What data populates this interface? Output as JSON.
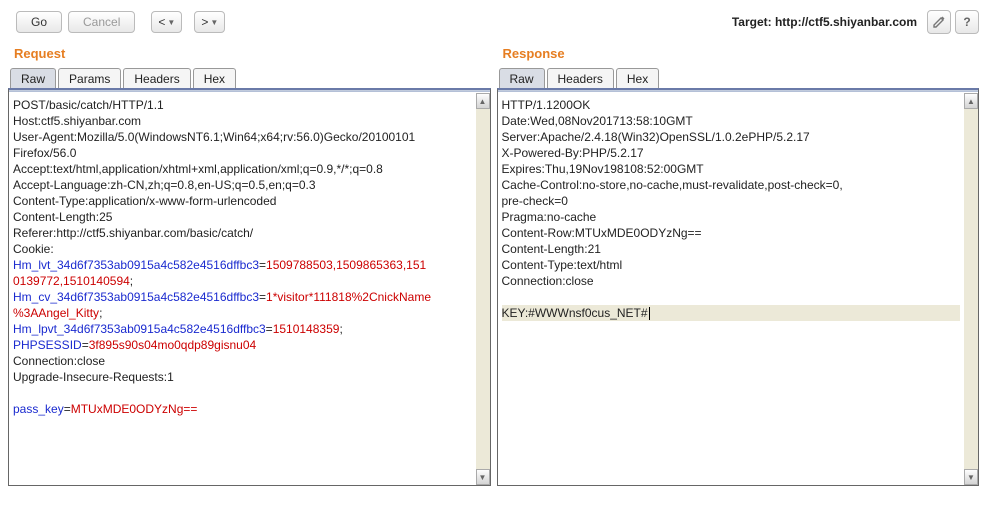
{
  "toolbar": {
    "go_label": "Go",
    "cancel_label": "Cancel",
    "prev_label": "<",
    "next_label": ">",
    "target_prefix": "Target: ",
    "target_url": "http://ctf5.shiyanbar.com",
    "help_label": "?"
  },
  "request": {
    "title": "Request",
    "tabs": {
      "raw": "Raw",
      "params": "Params",
      "headers": "Headers",
      "hex": "Hex"
    },
    "lines": [
      {
        "t": "POST/basic/catch/HTTP/1.1"
      },
      {
        "t": "Host:ctf5.shiyanbar.com"
      },
      {
        "t": "User-Agent:Mozilla/5.0(WindowsNT6.1;Win64;x64;rv:56.0)Gecko/20100101"
      },
      {
        "t": "Firefox/56.0"
      },
      {
        "t": "Accept:text/html,application/xhtml+xml,application/xml;q=0.9,*/*;q=0.8"
      },
      {
        "t": "Accept-Language:zh-CN,zh;q=0.8,en-US;q=0.5,en;q=0.3"
      },
      {
        "t": "Content-Type:application/x-www-form-urlencoded"
      },
      {
        "t": "Content-Length:25"
      },
      {
        "t": "Referer:http://ctf5.shiyanbar.com/basic/catch/"
      },
      {
        "t": "Cookie:"
      },
      {
        "pairs": [
          {
            "k": "Hm_lvt_34d6f7353ab0915a4c582e4516dffbc3",
            "v": "1509788503,1509865363,151"
          }
        ]
      },
      {
        "pairs": [
          {
            "k": "",
            "v": "0139772,1510140594",
            "semi": true
          }
        ]
      },
      {
        "pairs": [
          {
            "k": "Hm_cv_34d6f7353ab0915a4c582e4516dffbc3",
            "v": "1*visitor*111818%2CnickName"
          }
        ]
      },
      {
        "pairs": [
          {
            "k": "",
            "v": "%3AAngel_Kitty",
            "semi": true
          }
        ]
      },
      {
        "pairs": [
          {
            "k": "Hm_lpvt_34d6f7353ab0915a4c582e4516dffbc3",
            "v": "1510148359",
            "semi": true
          }
        ]
      },
      {
        "pairs": [
          {
            "k": "PHPSESSID",
            "v": "3f895s90s04mo0qdp89gisnu04"
          }
        ]
      },
      {
        "t": "Connection:close"
      },
      {
        "t": "Upgrade-Insecure-Requests:1"
      },
      {
        "t": ""
      },
      {
        "pairs": [
          {
            "k": "pass_key",
            "v": "MTUxMDE0ODYzNg=="
          }
        ]
      }
    ]
  },
  "response": {
    "title": "Response",
    "tabs": {
      "raw": "Raw",
      "headers": "Headers",
      "hex": "Hex"
    },
    "lines": [
      {
        "t": "HTTP/1.1200OK"
      },
      {
        "t": "Date:Wed,08Nov201713:58:10GMT"
      },
      {
        "t": "Server:Apache/2.4.18(Win32)OpenSSL/1.0.2ePHP/5.2.17"
      },
      {
        "t": "X-Powered-By:PHP/5.2.17"
      },
      {
        "t": "Expires:Thu,19Nov198108:52:00GMT"
      },
      {
        "t": "Cache-Control:no-store,no-cache,must-revalidate,post-check=0,"
      },
      {
        "t": "pre-check=0"
      },
      {
        "t": "Pragma:no-cache"
      },
      {
        "t": "Content-Row:MTUxMDE0ODYzNg=="
      },
      {
        "t": "Content-Length:21"
      },
      {
        "t": "Content-Type:text/html"
      },
      {
        "t": "Connection:close"
      },
      {
        "t": ""
      },
      {
        "t": "KEY:#WWWnsf0cus_NET#",
        "hl": true,
        "caret": true
      }
    ]
  }
}
